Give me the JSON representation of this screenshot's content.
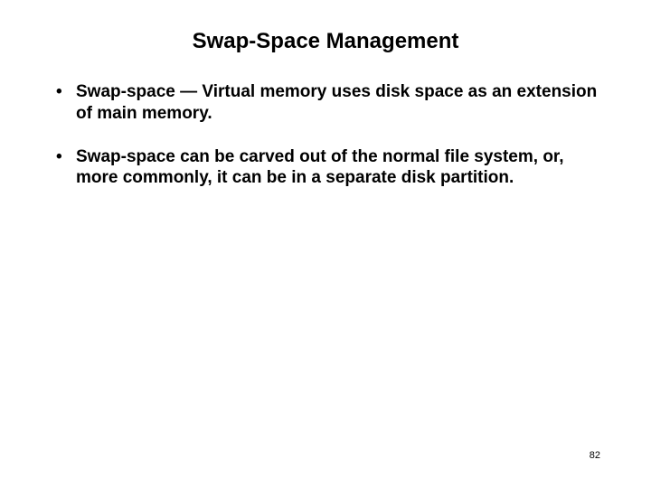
{
  "title": "Swap-Space Management",
  "bullets": [
    "Swap-space — Virtual memory uses disk space as an extension of main memory.",
    "Swap-space can be carved out of the normal file system, or, more commonly, it can be in a separate disk partition."
  ],
  "page_number": "82"
}
